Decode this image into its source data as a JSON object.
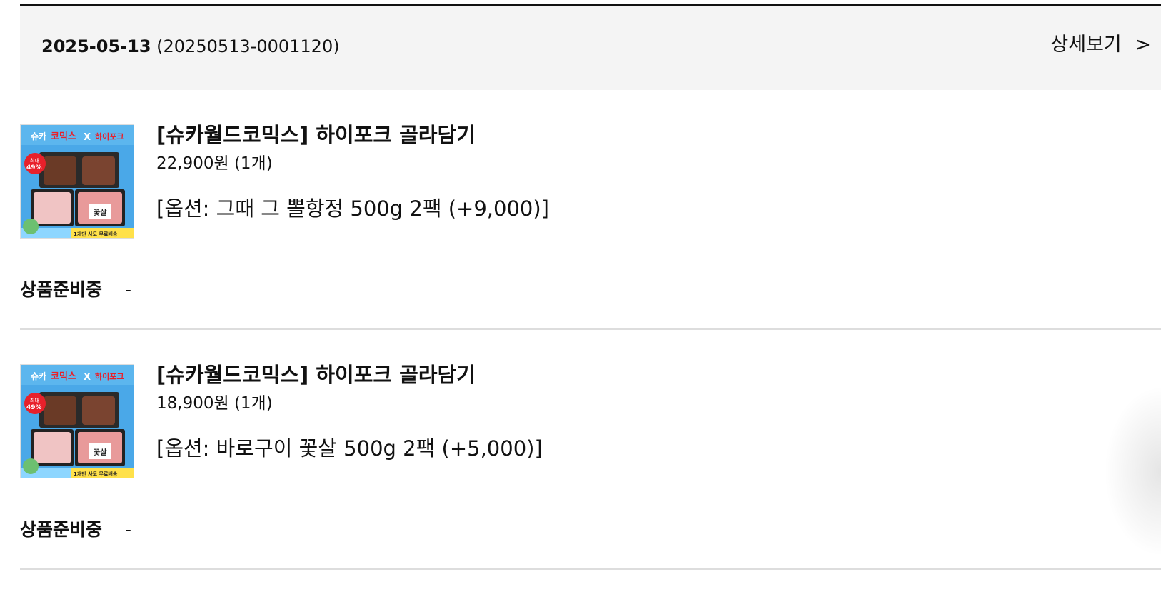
{
  "order": {
    "date": "2025-05-13",
    "number": "(20250513-0001120)",
    "detail_label": "상세보기",
    "detail_chevron": ">"
  },
  "items": [
    {
      "name": "[슈카월드코믹스] 하이포크 골라담기",
      "price": "22,900원 (1개)",
      "option": "[옵션: 그때 그 뽈항정 500g 2팩 (+9,000)]",
      "status": "상품준비중",
      "status_extra": "-",
      "thumbnail": {
        "brand_left": "슈카",
        "brand_mid": "코믹스",
        "brand_x": "X",
        "brand_right": "하이포크",
        "badge_top": "최대",
        "badge_pct": "49%",
        "pack_label": "꽃살",
        "footer": "1개만 사도 무료배송"
      }
    },
    {
      "name": "[슈카월드코믹스] 하이포크 골라담기",
      "price": "18,900원 (1개)",
      "option": "[옵션: 바로구이 꽃살 500g 2팩 (+5,000)]",
      "status": "상품준비중",
      "status_extra": "-",
      "thumbnail": {
        "brand_left": "슈카",
        "brand_mid": "코믹스",
        "brand_x": "X",
        "brand_right": "하이포크",
        "badge_top": "최대",
        "badge_pct": "49%",
        "pack_label": "꽃살",
        "footer": "1개만 사도 무료배송"
      }
    }
  ],
  "colors": {
    "header_bg": "#f4f4f4",
    "thumb_bg": "#4aa8e8",
    "badge": "#e8202a",
    "footer_band": "#ffe14a"
  }
}
